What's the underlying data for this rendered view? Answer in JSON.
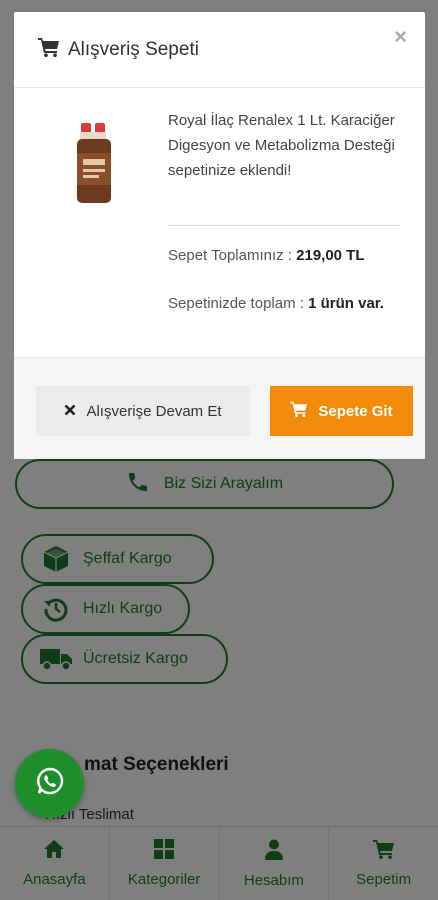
{
  "modal": {
    "title": "Alışveriş Sepeti",
    "close": "×",
    "product_text": "Royal İlaç Renalex 1 Lt. Karaciğer Digesyon ve Metabolizma Desteği sepetinize eklendi!",
    "total_label": "Sepet Toplamınız :",
    "total_value": "219,00 TL",
    "count_label": "Sepetinizde toplam :",
    "count_value": "1 ürün var.",
    "continue_label": "Alışverişe Devam Et",
    "cart_label": "Sepete Git"
  },
  "page": {
    "call_label": "Biz Sizi Arayalım",
    "features": [
      "Şeffaf Kargo",
      "Hızlı Kargo",
      "Ücretsiz Kargo"
    ],
    "section_title": "mat Seçenekleri",
    "section_sub": "Hızlı Teslimat"
  },
  "bottom_nav": [
    {
      "label": "Anasayfa",
      "icon": "home-icon"
    },
    {
      "label": "Kategoriler",
      "icon": "grid-icon"
    },
    {
      "label": "Hesabım",
      "icon": "user-icon"
    },
    {
      "label": "Sepetim",
      "icon": "cart-icon"
    }
  ],
  "colors": {
    "brand_green": "#1f7d2c",
    "cart_orange": "#f28a0a",
    "overlay": "rgba(0,0,0,0.5)"
  }
}
